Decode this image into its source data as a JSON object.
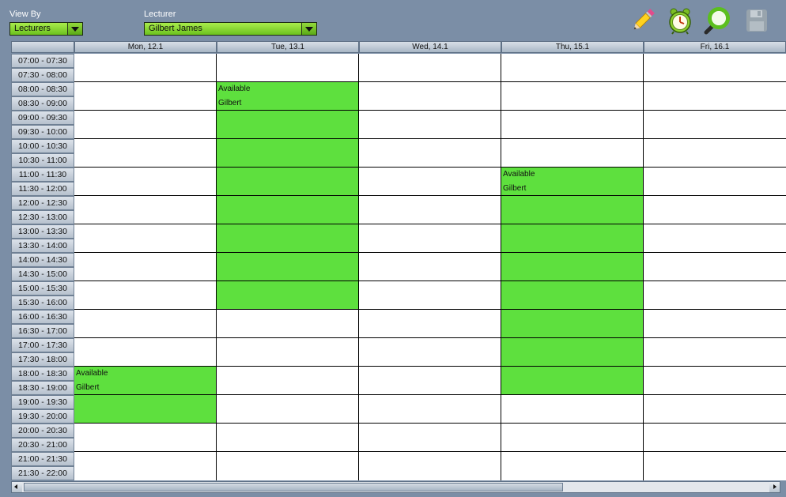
{
  "controls": {
    "view_by_label": "View By",
    "view_by_value": "Lecturers",
    "lecturer_label": "Lecturer",
    "lecturer_value": "Gilbert James"
  },
  "toolbar": [
    {
      "name": "edit-button",
      "icon": "pencil-icon"
    },
    {
      "name": "alarm-button",
      "icon": "alarm-clock-icon"
    },
    {
      "name": "search-button",
      "icon": "magnifier-icon"
    },
    {
      "name": "save-button",
      "icon": "floppy-disk-icon",
      "disabled": true
    }
  ],
  "days": [
    "Mon, 12.1",
    "Tue, 13.1",
    "Wed, 14.1",
    "Thu, 15.1",
    "Fri, 16.1"
  ],
  "time_slots": [
    "07:00 - 07:30",
    "07:30 - 08:00",
    "08:00 - 08:30",
    "08:30 - 09:00",
    "09:00 - 09:30",
    "09:30 - 10:00",
    "10:00 - 10:30",
    "10:30 - 11:00",
    "11:00 - 11:30",
    "11:30 - 12:00",
    "12:00 - 12:30",
    "12:30 - 13:00",
    "13:00 - 13:30",
    "13:30 - 14:00",
    "14:00 - 14:30",
    "14:30 - 15:00",
    "15:00 - 15:30",
    "15:30 - 16:00",
    "16:00 - 16:30",
    "16:30 - 17:00",
    "17:00 - 17:30",
    "17:30 - 18:00",
    "18:00 - 18:30",
    "18:30 - 19:00",
    "19:00 - 19:30",
    "19:30 - 20:00",
    "20:00 - 20:30",
    "20:30 - 21:00",
    "21:00 - 21:30",
    "21:30 - 22:00"
  ],
  "events": [
    {
      "day": 1,
      "start": "08:00",
      "end": "16:00",
      "title": "Available",
      "person": "Gilbert"
    },
    {
      "day": 3,
      "start": "11:00",
      "end": "19:00",
      "title": "Available",
      "person": "Gilbert"
    },
    {
      "day": 0,
      "start": "18:00",
      "end": "20:00",
      "title": "Available",
      "person": "Gilbert"
    }
  ],
  "colors": {
    "background": "#7b8ea6",
    "event": "#5ee03e",
    "combo": "#7fd22e"
  }
}
